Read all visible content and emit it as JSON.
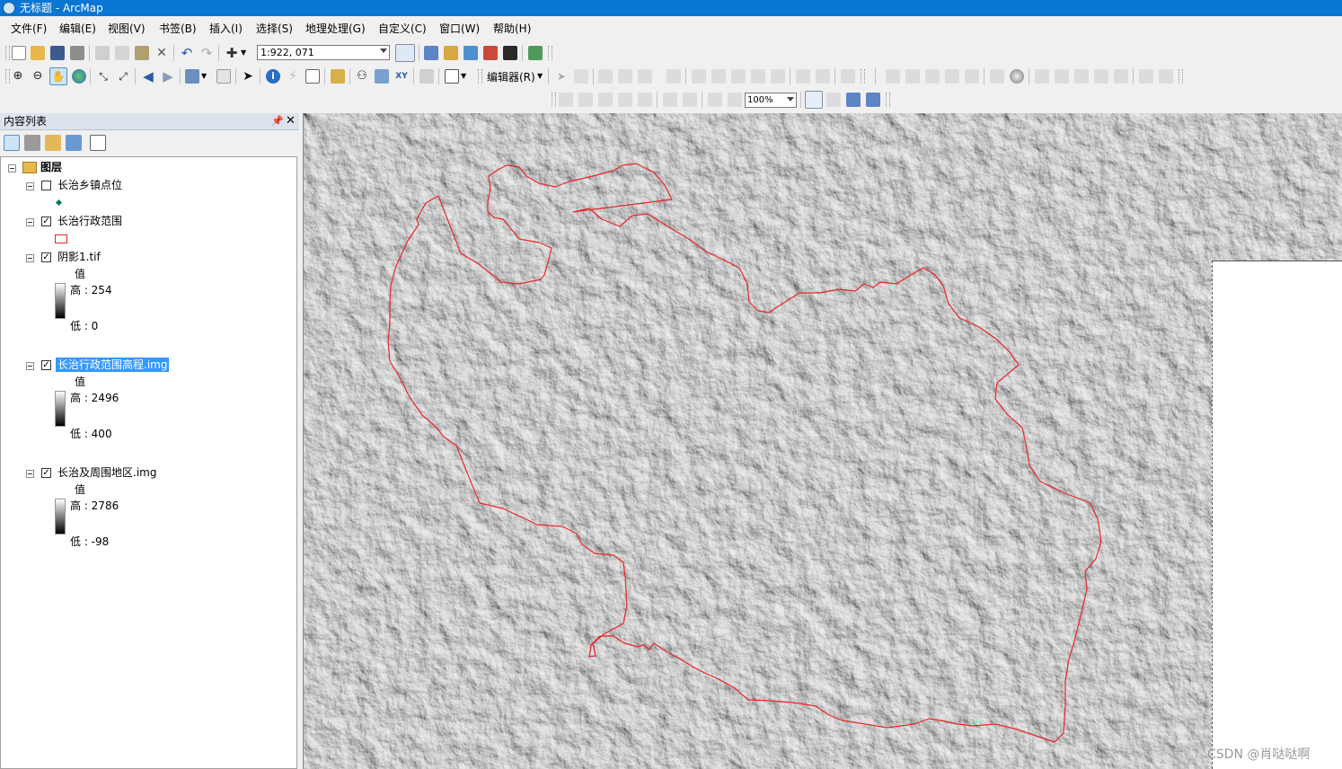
{
  "titlebar": {
    "title": "无标题 - ArcMap"
  },
  "menu": [
    "文件(F)",
    "编辑(E)",
    "视图(V)",
    "书签(B)",
    "插入(I)",
    "选择(S)",
    "地理处理(G)",
    "自定义(C)",
    "窗口(W)",
    "帮助(H)"
  ],
  "toolbar": {
    "scale": "1:922, 071",
    "editor_label": "编辑器(R)",
    "zoom": "100%"
  },
  "toc": {
    "title": "内容列表",
    "root": "图层",
    "layers": [
      {
        "name": "长治乡镇点位",
        "checked": false
      },
      {
        "name": "长治行政范围",
        "checked": true
      },
      {
        "name": "阴影1.tif",
        "checked": true,
        "legend_title": "值",
        "high": "高 : 254",
        "low": "低 : 0"
      },
      {
        "name": "长治行政范围高程.img",
        "checked": true,
        "selected": true,
        "legend_title": "值",
        "high": "高 : 2496",
        "low": "低 : 400"
      },
      {
        "name": "长治及周围地区.img",
        "checked": true,
        "legend_title": "值",
        "high": "高 : 2786",
        "low": "低 : -98"
      }
    ]
  },
  "colors": {
    "titlebar": "#0a76d4",
    "boundary": "#e8262b",
    "selection": "#3399ff"
  },
  "watermark": "CSDN @肖哒哒啊"
}
